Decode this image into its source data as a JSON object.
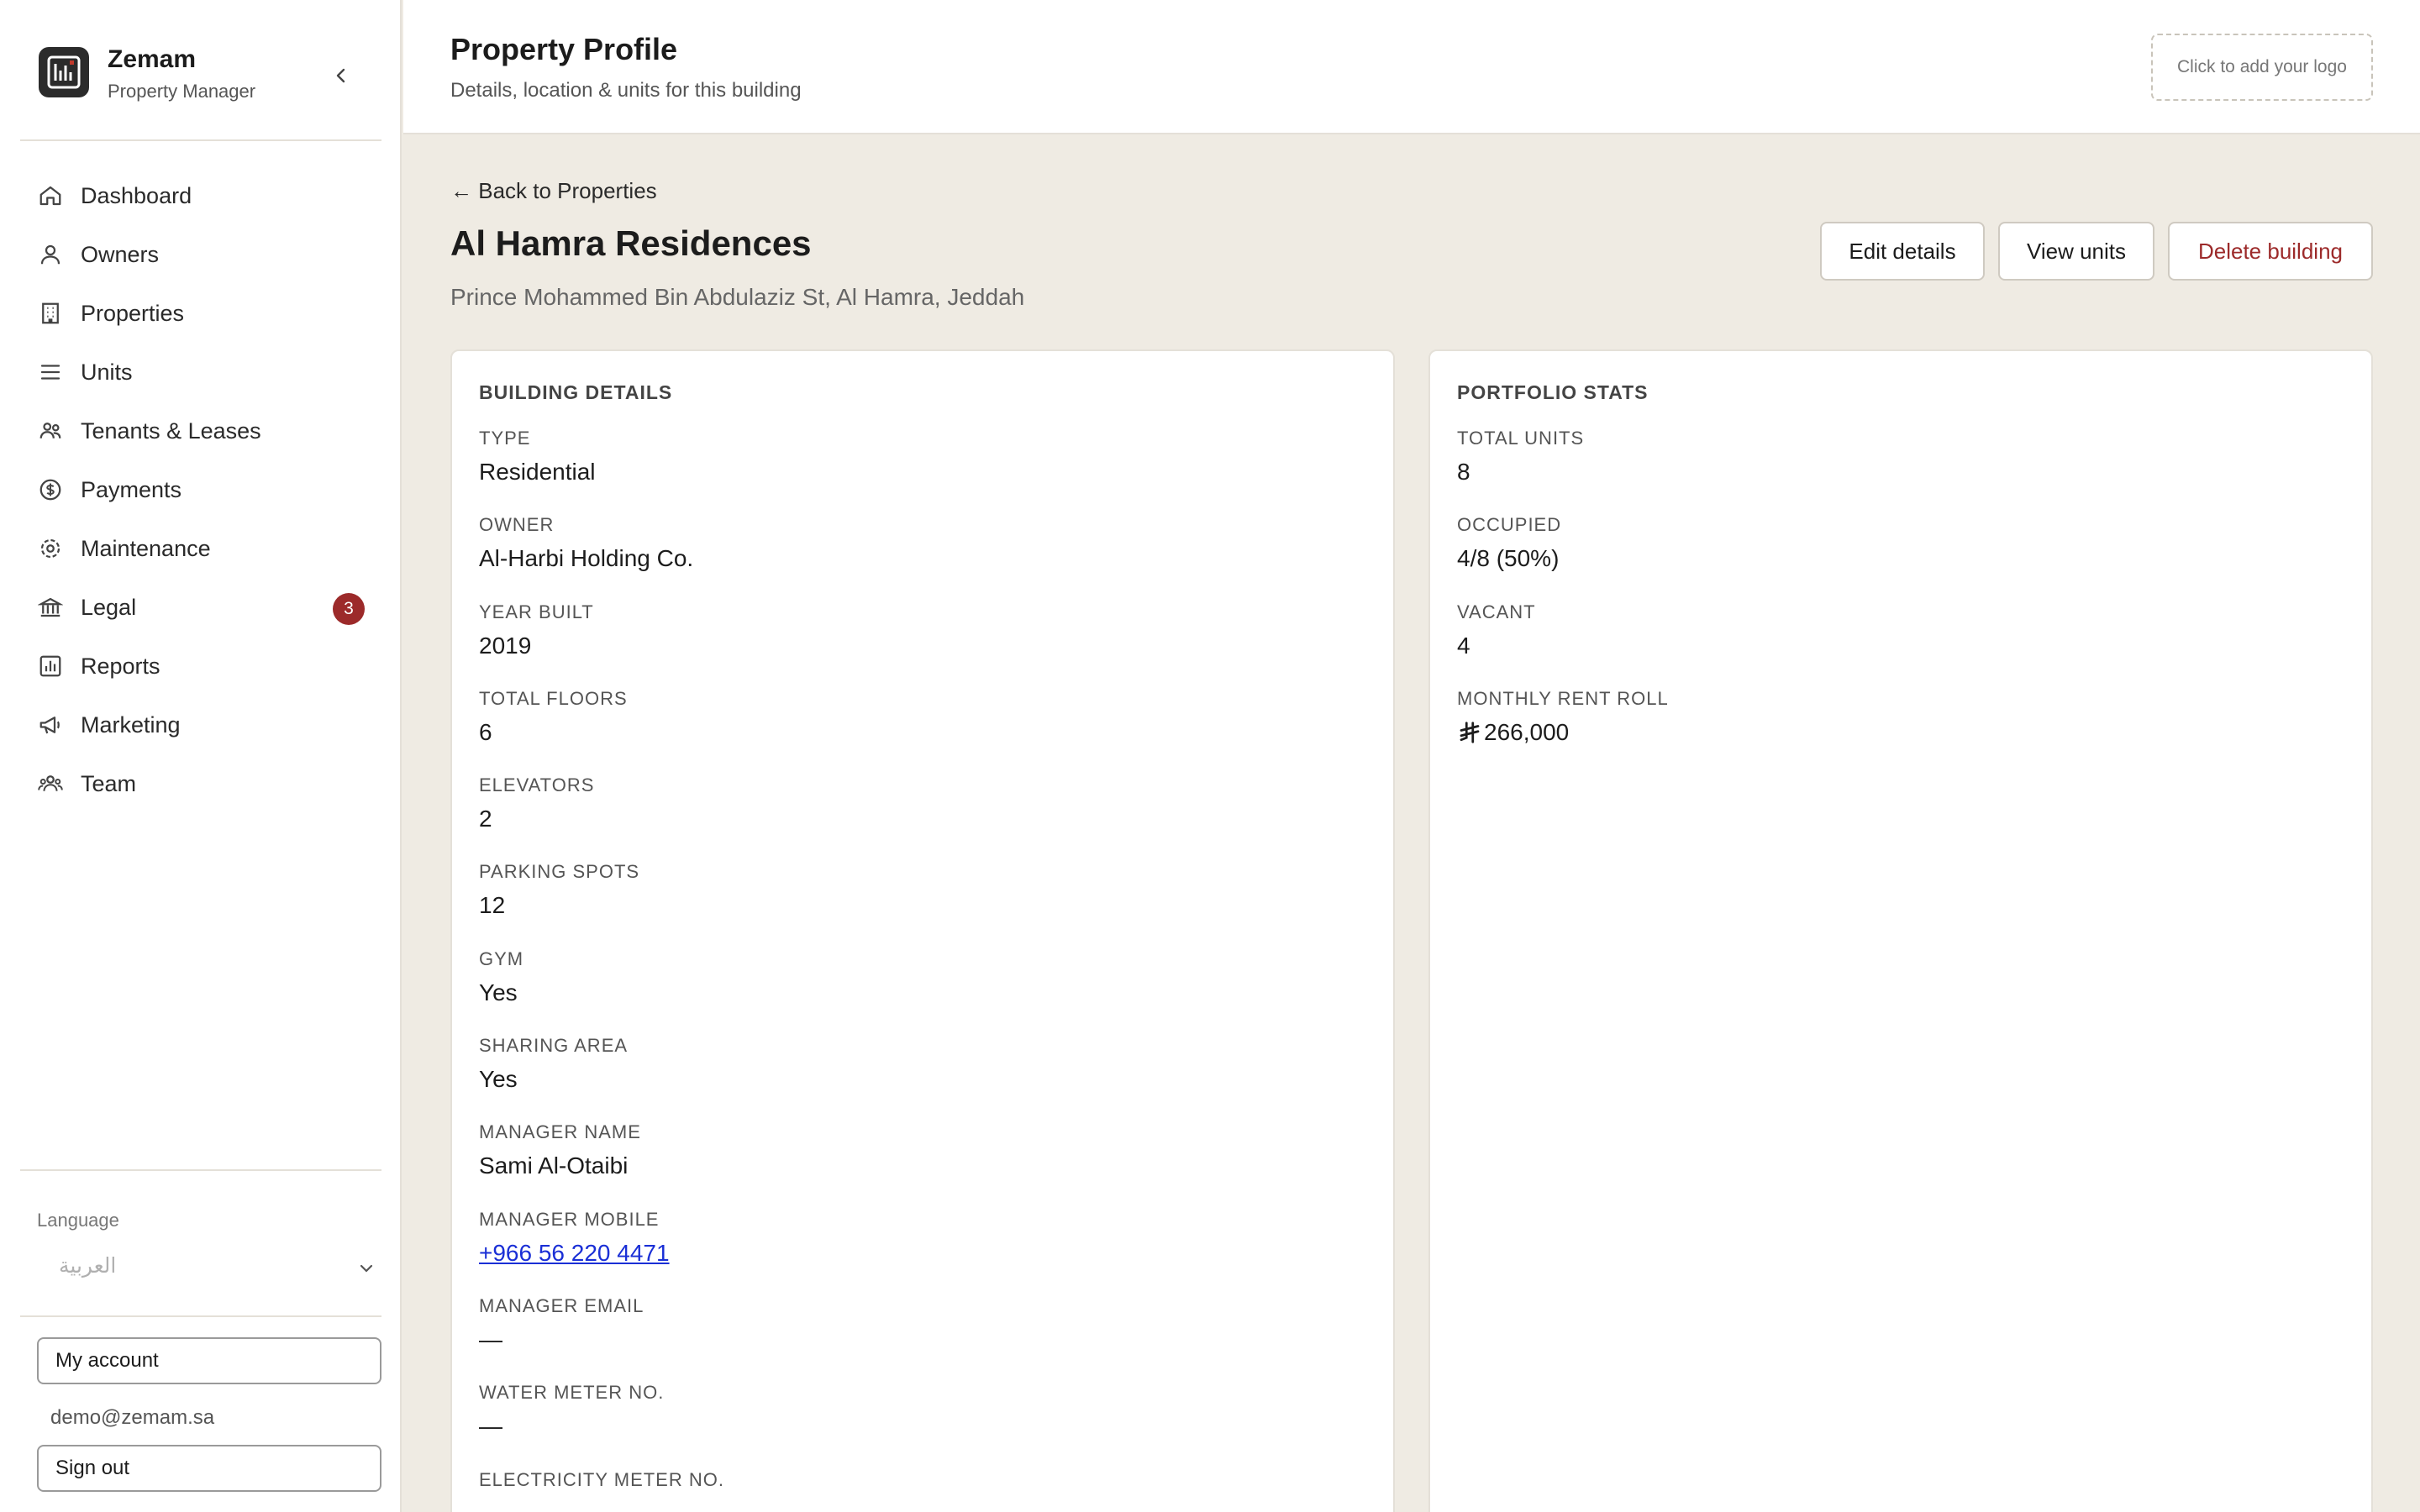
{
  "brand": {
    "name": "Zemam",
    "subtitle": "Property Manager"
  },
  "nav": [
    {
      "label": "Dashboard",
      "icon": "home-icon"
    },
    {
      "label": "Owners",
      "icon": "user-icon"
    },
    {
      "label": "Properties",
      "icon": "building-icon"
    },
    {
      "label": "Units",
      "icon": "list-icon"
    },
    {
      "label": "Tenants & Leases",
      "icon": "users-icon"
    },
    {
      "label": "Payments",
      "icon": "dollar-icon"
    },
    {
      "label": "Maintenance",
      "icon": "gear-icon"
    },
    {
      "label": "Legal",
      "icon": "bank-icon",
      "badge": "3"
    },
    {
      "label": "Reports",
      "icon": "chart-icon"
    },
    {
      "label": "Marketing",
      "icon": "megaphone-icon"
    },
    {
      "label": "Team",
      "icon": "team-icon"
    }
  ],
  "language": {
    "label": "Language",
    "selected": "العربية"
  },
  "account": {
    "my_account": "My account",
    "email": "demo@zemam.sa",
    "sign_out": "Sign out"
  },
  "header": {
    "title": "Property Profile",
    "subtitle": "Details, location & units for this building",
    "logo_placeholder": "Click to add your logo"
  },
  "property": {
    "back": "← Back to Properties",
    "name": "Al Hamra Residences",
    "address": "Prince Mohammed Bin Abdulaziz St, Al Hamra, Jeddah",
    "actions": {
      "edit": "Edit details",
      "units": "View units",
      "delete": "Delete building"
    }
  },
  "building_details": {
    "heading": "BUILDING DETAILS",
    "fields": [
      {
        "label": "TYPE",
        "value": "Residential"
      },
      {
        "label": "OWNER",
        "value": "Al-Harbi Holding Co."
      },
      {
        "label": "YEAR BUILT",
        "value": "2019"
      },
      {
        "label": "TOTAL FLOORS",
        "value": "6"
      },
      {
        "label": "ELEVATORS",
        "value": "2"
      },
      {
        "label": "PARKING SPOTS",
        "value": "12"
      },
      {
        "label": "GYM",
        "value": "Yes"
      },
      {
        "label": "SHARING AREA",
        "value": "Yes"
      },
      {
        "label": "MANAGER NAME",
        "value": "Sami Al-Otaibi"
      },
      {
        "label": "MANAGER MOBILE",
        "value": "+966 56 220 4471"
      },
      {
        "label": "MANAGER EMAIL",
        "value": "—"
      },
      {
        "label": "WATER METER NO.",
        "value": "—"
      },
      {
        "label": "ELECTRICITY METER NO.",
        "value": "—"
      }
    ]
  },
  "portfolio_stats": {
    "heading": "PORTFOLIO STATS",
    "fields": [
      {
        "label": "TOTAL UNITS",
        "value": "8"
      },
      {
        "label": "OCCUPIED",
        "value": "4/8 (50%)"
      },
      {
        "label": "VACANT",
        "value": "4"
      },
      {
        "label": "MONTHLY RENT ROLL",
        "value": "266,000"
      }
    ]
  },
  "colors": {
    "accent_red": "#9c2a2a",
    "link_blue": "#1a2fd6",
    "page_bg": "#efebe3"
  }
}
